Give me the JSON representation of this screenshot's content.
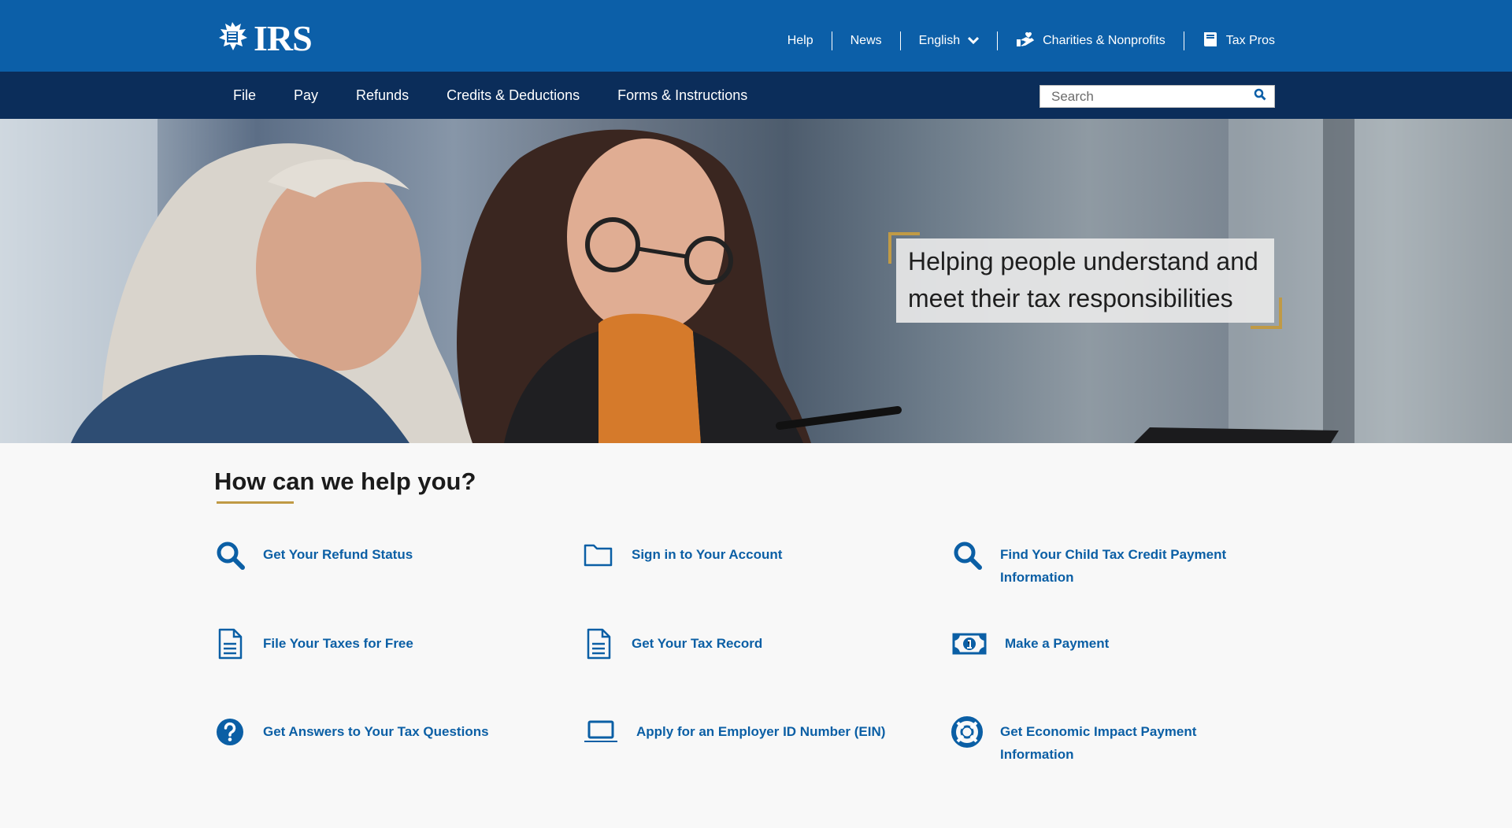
{
  "header": {
    "logo_text": "IRS",
    "utility_links": [
      {
        "label": "Help"
      },
      {
        "label": "News"
      },
      {
        "label": "English"
      },
      {
        "label": "Charities & Nonprofits"
      },
      {
        "label": "Tax Pros"
      }
    ]
  },
  "nav": {
    "items": [
      "File",
      "Pay",
      "Refunds",
      "Credits & Deductions",
      "Forms & Instructions"
    ],
    "search_placeholder": "Search"
  },
  "hero": {
    "tagline": "Helping people understand and meet their tax responsibilities"
  },
  "help": {
    "title": "How can we help you?",
    "items": [
      {
        "label": "Get Your Refund Status",
        "icon": "search-icon"
      },
      {
        "label": "Sign in to Your Account",
        "icon": "folder-icon"
      },
      {
        "label": "Find Your Child Tax Credit Payment Information",
        "icon": "search-icon"
      },
      {
        "label": "File Your Taxes for Free",
        "icon": "document-icon"
      },
      {
        "label": "Get Your Tax Record",
        "icon": "document-icon"
      },
      {
        "label": "Make a Payment",
        "icon": "money-icon"
      },
      {
        "label": "Get Answers to Your Tax Questions",
        "icon": "question-icon"
      },
      {
        "label": "Apply for an Employer ID Number (EIN)",
        "icon": "laptop-icon"
      },
      {
        "label": "Get Economic Impact Payment Information",
        "icon": "lifebuoy-icon"
      }
    ]
  },
  "colors": {
    "top_bar": "#0c5fa8",
    "nav_bar": "#0b2d5a",
    "link_blue": "#0b5fa5",
    "accent_gold": "#c09a45"
  }
}
